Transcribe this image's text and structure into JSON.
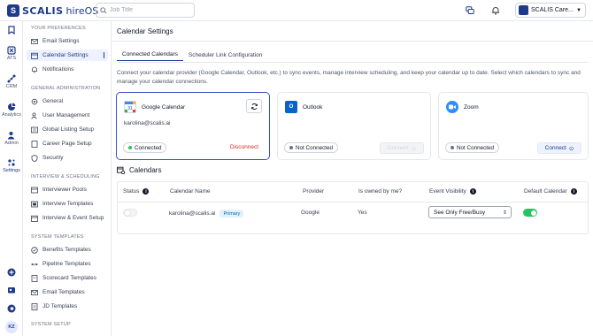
{
  "app": {
    "brand": "SCALIS",
    "product": "hireOS",
    "brand_color": "#1e3a8a"
  },
  "topbar": {
    "search_placeholder": "Job Title",
    "account_name": "SCALIS Care...",
    "icons": [
      "search-icon",
      "chat-icon",
      "bell-icon",
      "chevron-down-icon"
    ]
  },
  "rail": {
    "items": [
      {
        "label": "",
        "icon": "bookmark-icon"
      },
      {
        "label": "ATS",
        "icon": "ats-icon"
      },
      {
        "label": "CRM",
        "icon": "crm-icon"
      },
      {
        "label": "Analytics",
        "icon": "analytics-icon"
      },
      {
        "label": "Admin",
        "icon": "admin-icon"
      },
      {
        "label": "Settings",
        "icon": "settings-icon"
      }
    ],
    "avatar_initials": "KZ"
  },
  "nav": {
    "sections": {
      "preferences": "YOUR PREFERENCES",
      "general_admin": "GENERAL ADMINISTRATION",
      "interview": "INTERVIEW & SCHEDULING",
      "templates": "SYSTEM TEMPLATES",
      "setup": "SYSTEM SETUP"
    },
    "items": {
      "email_settings": "Email Settings",
      "calendar_settings": "Calendar Settings",
      "notifications": "Notifications",
      "general": "General",
      "user_management": "User Management",
      "global_listing_setup": "Global Listing Setup",
      "career_page_setup": "Career Page Setup",
      "security": "Security",
      "interviewer_pools": "Interviewer Pools",
      "interview_templates": "Interview Templates",
      "interview_event_setup": "Interview & Event Setup",
      "benefits_templates": "Benefits Templates",
      "pipeline_templates": "Pipeline Templates",
      "scorecard_templates": "Scorecard Templates",
      "email_templates": "Email Templates",
      "jd_templates": "JD Templates"
    }
  },
  "main": {
    "title": "Calendar Settings",
    "tabs": [
      "Connected Calendars",
      "Scheduler Link Configuration"
    ],
    "description": "Connect your calendar provider (Google Calendar, Outlook, etc.) to sync events, manage interview scheduling, and keep your calendar up to date. Select which calendars to sync and manage your calendar connections.",
    "providers": [
      {
        "name": "Google Calendar",
        "email": "karolina@scalis.ai",
        "status": "Connected",
        "action": "Disconnect",
        "icon": "google-calendar-icon"
      },
      {
        "name": "Outlook",
        "email": "",
        "status": "Not Connected",
        "action": "Connect",
        "icon": "outlook-icon"
      },
      {
        "name": "Zoom",
        "email": "",
        "status": "Not Connected",
        "action": "Connect",
        "icon": "zoom-icon"
      }
    ],
    "calendars_title": "Calendars",
    "table": {
      "headers": [
        "Status",
        "Calendar Name",
        "Provider",
        "Is owned by me?",
        "Event Visibility",
        "Default Calendar"
      ],
      "rows": [
        {
          "calendar_name": "karolina@scalis.ai",
          "badge": "Primary",
          "provider": "Google",
          "owned": "Yes",
          "visibility": "See Only Free/Busy",
          "status_on": false,
          "default_on": true
        }
      ]
    }
  },
  "colors": {
    "accent": "#1e3a8a",
    "connected": "#22c55e",
    "danger": "#dc2626"
  }
}
